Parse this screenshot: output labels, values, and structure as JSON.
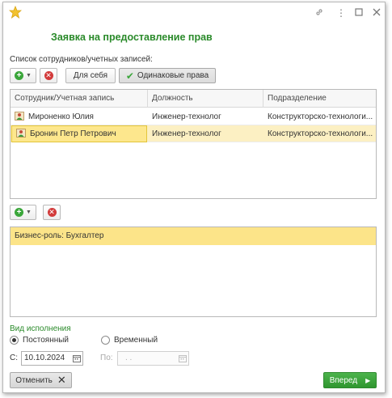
{
  "window": {
    "title": "Заявка на предоставление прав"
  },
  "employees": {
    "label": "Список сотрудников/учетных записей:",
    "toolbar": {
      "for_self_label": "Для себя",
      "same_rights_label": "Одинаковые права"
    },
    "columns": [
      "Сотрудник/Учетная запись",
      "Должность",
      "Подразделение"
    ],
    "rows": [
      [
        "Мироненко Юлия",
        "Инженер-технолог",
        "Конструкторско-технологи..."
      ],
      [
        "Бронин Петр Петрович",
        "Инженер-технолог",
        "Конструкторско-технологи..."
      ]
    ]
  },
  "roles": {
    "rows": [
      "Бизнес-роль: Бухгалтер"
    ]
  },
  "execution": {
    "section_label": "Вид исполнения",
    "permanent_label": "Постоянный",
    "temporary_label": "Временный",
    "selected": "permanent",
    "from_label": "С:",
    "from_value": "10.10.2024",
    "to_label": "По:",
    "to_value": ". ."
  },
  "footer": {
    "cancel_label": "Отменить",
    "next_label": "Вперед"
  },
  "colors": {
    "accent_green": "#2a8a2a",
    "selection_yellow": "#fde78d",
    "row_highlight": "#fcf0c3"
  }
}
